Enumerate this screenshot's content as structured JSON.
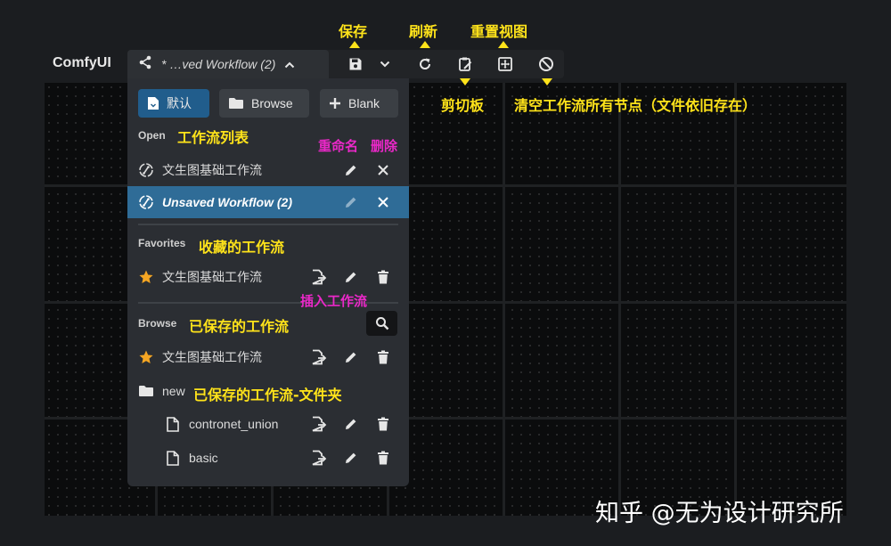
{
  "app": {
    "logo": "ComfyUI"
  },
  "tab": {
    "title": "* …ved Workflow (2)"
  },
  "panel": {
    "buttons": {
      "default": "默认",
      "browse": "Browse",
      "blank": "Blank"
    },
    "open": {
      "heading": "Open",
      "items": [
        {
          "name": "文生图基础工作流",
          "active": false
        },
        {
          "name": "Unsaved Workflow (2)",
          "active": true
        }
      ]
    },
    "favorites": {
      "heading": "Favorites",
      "items": [
        {
          "name": "文生图基础工作流"
        }
      ]
    },
    "browse": {
      "heading": "Browse",
      "items": [
        {
          "name": "文生图基础工作流"
        },
        {
          "name": "new"
        },
        {
          "name": "contronet_union"
        },
        {
          "name": "basic"
        }
      ]
    }
  },
  "annotations": {
    "save": "保存",
    "refresh": "刷新",
    "reset_view": "重置视图",
    "clipboard": "剪切板",
    "clear": "清空工作流所有节点（文件依旧存在）",
    "workflow_list": "工作流列表",
    "rename": "重命名",
    "delete": "删除",
    "favorites": "收藏的工作流",
    "insert": "插入工作流",
    "saved": "已保存的工作流",
    "saved_folder": "已保存的工作流-文件夹"
  },
  "watermark": "知乎 @无为设计研究所",
  "colors": {
    "accent": "#215d8c",
    "active_row": "#2f6c97",
    "annotation_yellow": "#ffe31a",
    "annotation_magenta": "#ea28c8",
    "star": "#f5a623"
  }
}
